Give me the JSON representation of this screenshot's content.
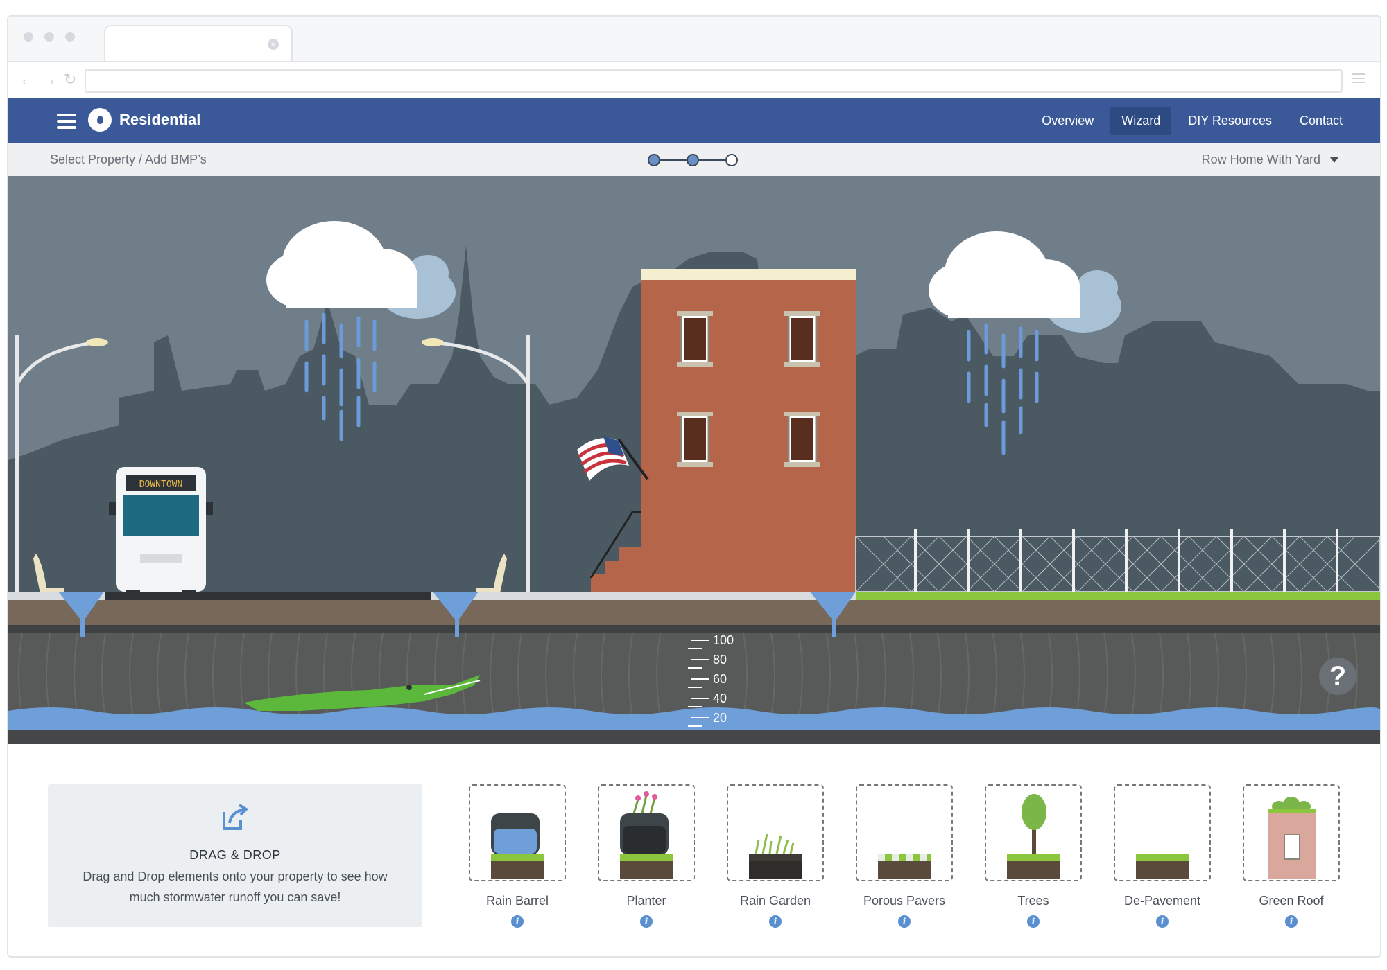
{
  "app": {
    "brand": "Residential",
    "nav": [
      "Overview",
      "Wizard",
      "DIY Resources",
      "Contact"
    ],
    "active_nav": "Wizard"
  },
  "subbar": {
    "breadcrumb": "Select Property / Add BMP’s",
    "property": "Row Home With Yard",
    "steps_total": 3,
    "steps_complete": 2
  },
  "scene": {
    "bus_sign": "DOWNTOWN",
    "gauge": [
      "100",
      "80",
      "60",
      "40",
      "20"
    ],
    "help": "?"
  },
  "dragdrop": {
    "title": "DRAG & DROP",
    "text": "Drag and Drop elements onto your property to see how much stormwater runoff you can save!"
  },
  "bmps": [
    {
      "label": "Rain Barrel",
      "icon": "rain-barrel-icon"
    },
    {
      "label": "Planter",
      "icon": "planter-icon"
    },
    {
      "label": "Rain Garden",
      "icon": "rain-garden-icon"
    },
    {
      "label": "Porous Pavers",
      "icon": "porous-pavers-icon"
    },
    {
      "label": "Trees",
      "icon": "tree-icon"
    },
    {
      "label": "De-Pavement",
      "icon": "de-pavement-icon"
    },
    {
      "label": "Green Roof",
      "icon": "green-roof-icon"
    }
  ],
  "colors": {
    "nav": "#3b5998",
    "sky": "#6e7f8a",
    "rain": "#6b9bd8",
    "brick": "#b5654a",
    "grass": "#8cc63f",
    "water": "#6e9fd8"
  }
}
